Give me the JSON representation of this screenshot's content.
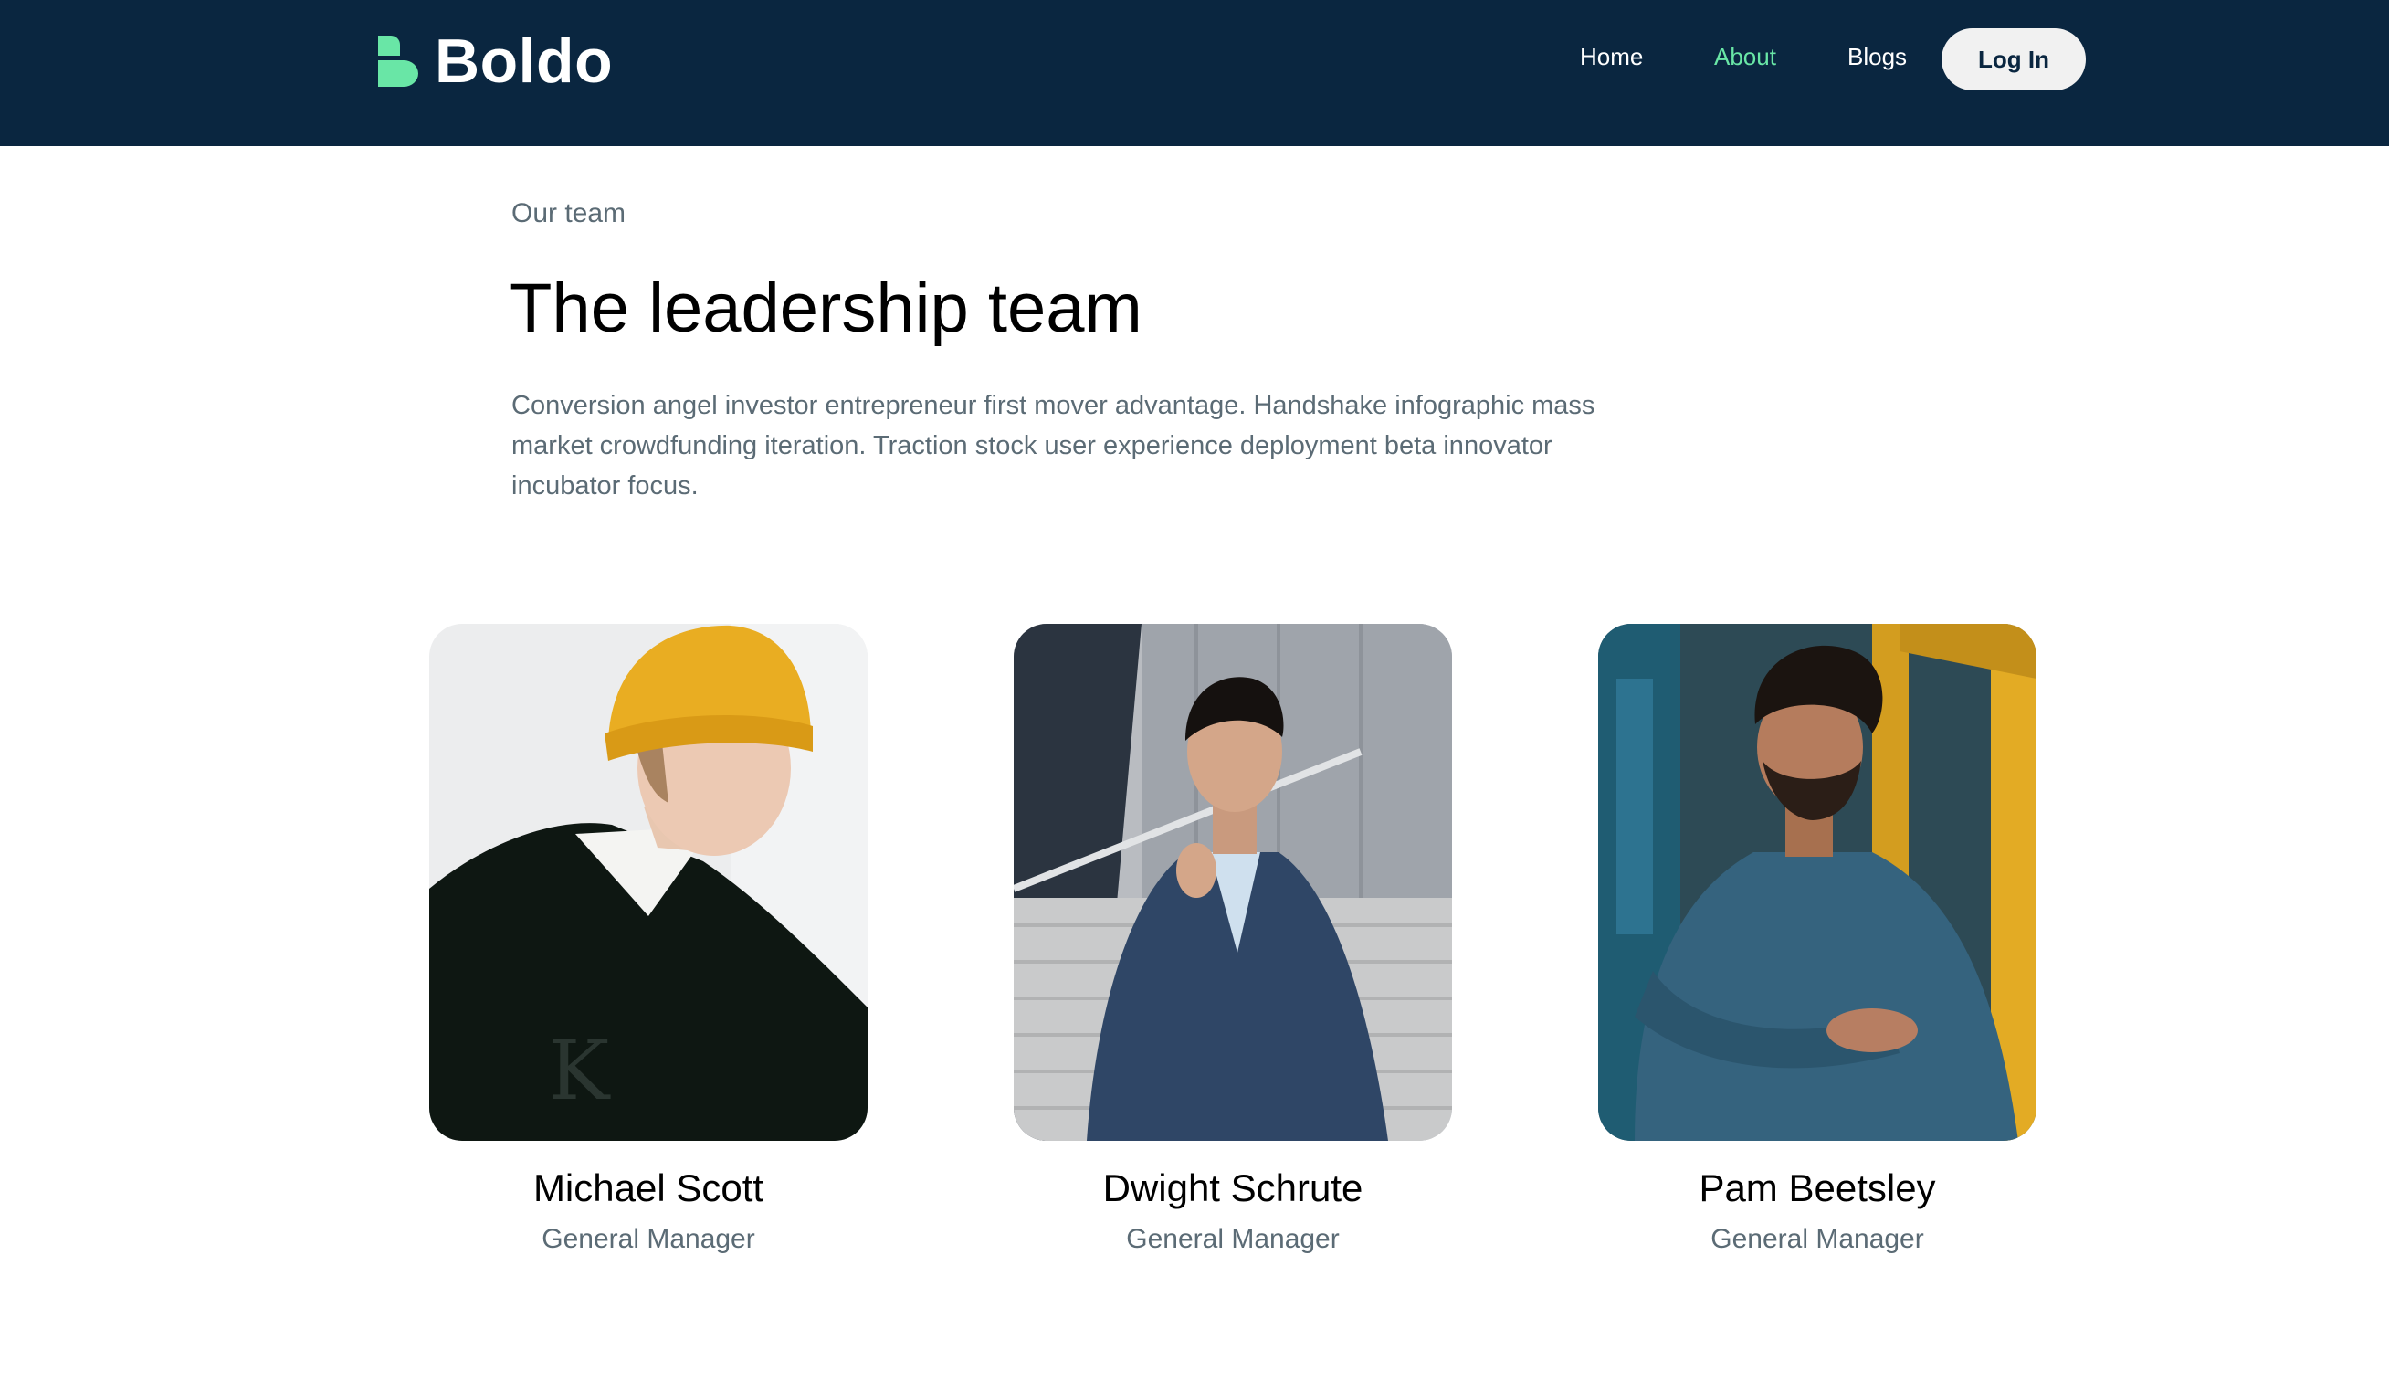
{
  "header": {
    "brand": "Boldo",
    "nav": [
      {
        "label": "Home"
      },
      {
        "label": "About"
      },
      {
        "label": "Blogs"
      }
    ],
    "login_label": "Log In"
  },
  "intro": {
    "eyebrow": "Our team",
    "title": "The leadership team",
    "description": "Conversion angel investor entrepreneur first mover advantage. Handshake infographic mass market crowdfunding iteration. Traction stock user experience deployment beta innovator incubator focus."
  },
  "team": [
    {
      "name": "Michael Scott",
      "role": "General Manager"
    },
    {
      "name": "Dwight Schrute",
      "role": "General Manager"
    },
    {
      "name": "Pam Beetsley",
      "role": "General Manager"
    }
  ],
  "colors": {
    "header_bg": "#0a2640",
    "accent": "#69e6a6",
    "muted_text": "#5b6b75"
  }
}
